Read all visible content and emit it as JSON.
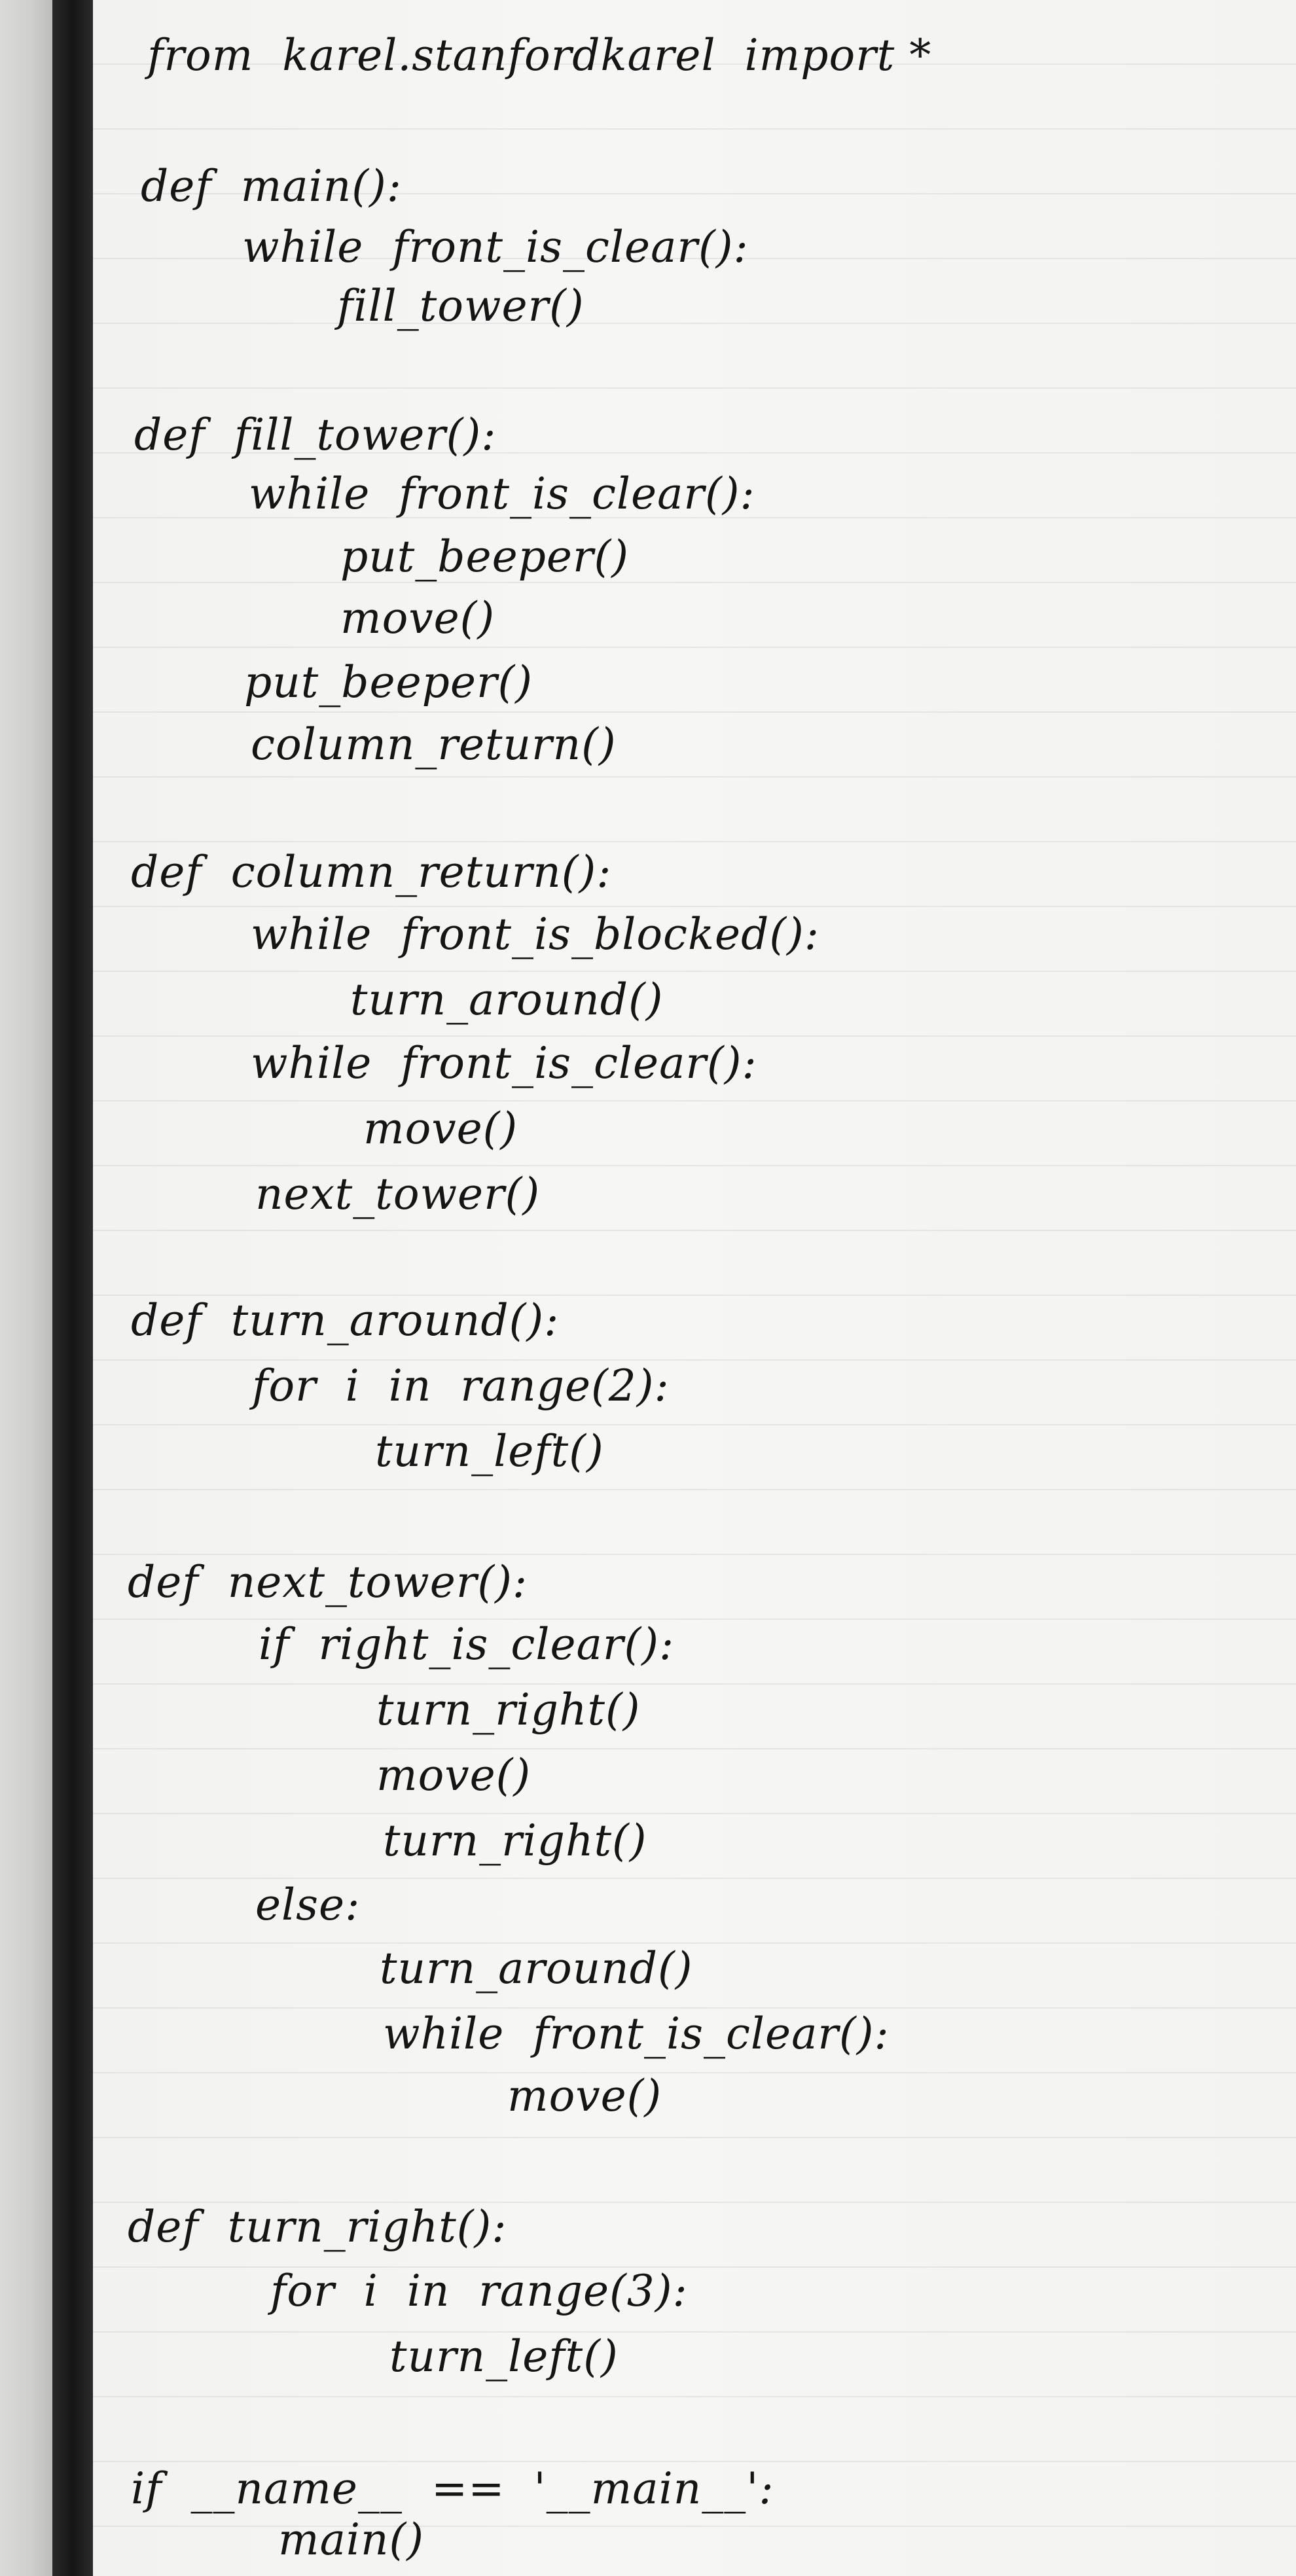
{
  "code": [
    "from  karel.stanfordkarel  import *",
    "def  main():",
    "while  front_is_clear():",
    "fill_tower()",
    "def  fill_tower():",
    "while  front_is_clear():",
    "put_beeper()",
    "move()",
    "put_beeper()",
    "column_return()",
    "def  column_return():",
    "while  front_is_blocked():",
    "turn_around()",
    "while  front_is_clear():",
    "move()",
    "next_tower()",
    "def  turn_around():",
    "for  i  in  range(2):",
    "turn_left()",
    "def  next_tower():",
    "if  right_is_clear():",
    "turn_right()",
    "move()",
    "turn_right()",
    "else:",
    "turn_around()",
    "while  front_is_clear():",
    "move()",
    "def  turn_right():",
    "for  i  in  range(3):",
    "turn_left()",
    "if  __name__  ==  '__main__':",
    "main()"
  ]
}
